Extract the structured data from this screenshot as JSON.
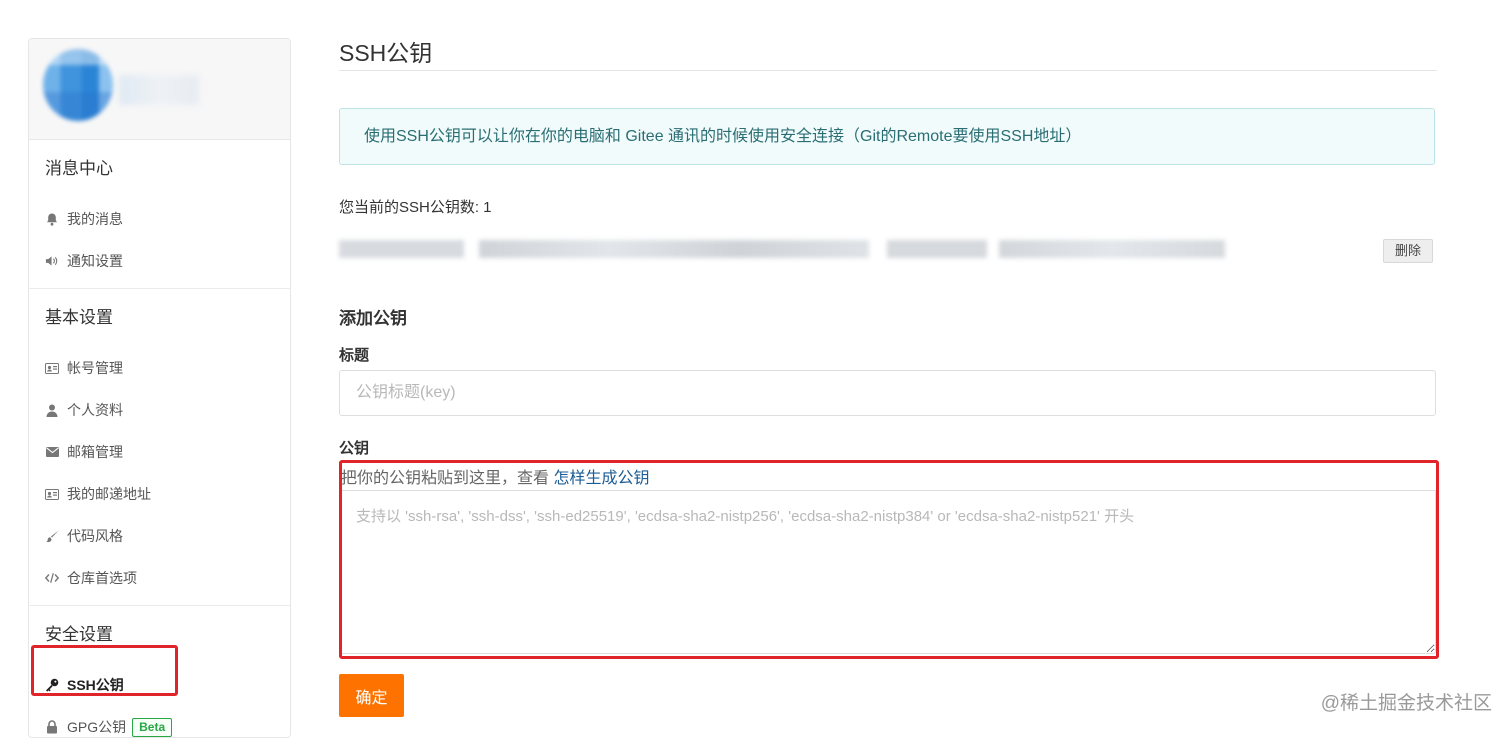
{
  "sidebar": {
    "groups": [
      {
        "title": "消息中心",
        "items": [
          {
            "label": "我的消息",
            "icon": "bell-icon"
          },
          {
            "label": "通知设置",
            "icon": "speaker-icon"
          }
        ]
      },
      {
        "title": "基本设置",
        "items": [
          {
            "label": "帐号管理",
            "icon": "id-card-icon"
          },
          {
            "label": "个人资料",
            "icon": "user-icon"
          },
          {
            "label": "邮箱管理",
            "icon": "envelope-icon"
          },
          {
            "label": "我的邮递地址",
            "icon": "id-card-icon"
          },
          {
            "label": "代码风格",
            "icon": "brush-icon"
          },
          {
            "label": "仓库首选项",
            "icon": "code-icon"
          }
        ]
      },
      {
        "title": "安全设置",
        "items": [
          {
            "label": "SSH公钥",
            "icon": "key-icon",
            "active": true
          },
          {
            "label": "GPG公钥",
            "icon": "lock-icon",
            "badge": "Beta"
          }
        ]
      }
    ]
  },
  "main": {
    "title": "SSH公钥",
    "info": "使用SSH公钥可以让你在你的电脑和 Gitee 通讯的时候使用安全连接（Git的Remote要使用SSH地址）",
    "count_text": "您当前的SSH公钥数: 1",
    "delete_label": "删除",
    "add_title": "添加公钥",
    "title_label": "标题",
    "title_placeholder": "公钥标题(key)",
    "key_label": "公钥",
    "key_hint": "把你的公钥粘贴到这里，查看 ",
    "key_hint_link": "怎样生成公钥",
    "key_placeholder": "支持以 'ssh-rsa', 'ssh-dss', 'ssh-ed25519', 'ecdsa-sha2-nistp256', 'ecdsa-sha2-nistp384' or 'ecdsa-sha2-nistp521' 开头",
    "submit_label": "确定"
  },
  "watermark": "@稀土掘金技术社区",
  "colors": {
    "accent_orange": "#fe7300",
    "highlight_red": "#e0242a",
    "info_bg": "#f1fbfb",
    "info_text": "#2a6e73",
    "link_blue": "#1c5d96",
    "beta_green": "#28a745"
  }
}
